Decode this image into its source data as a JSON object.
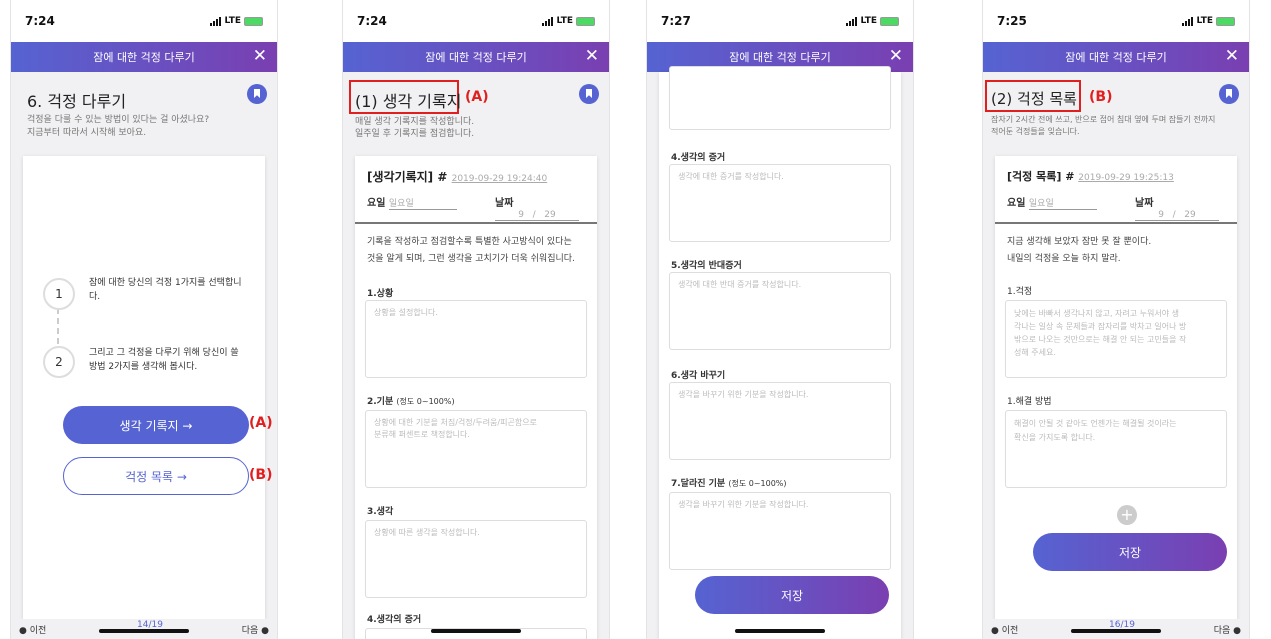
{
  "status": {
    "time1": "7:24",
    "time2": "7:24",
    "time3": "7:27",
    "time4": "7:25",
    "network": "LTE"
  },
  "header_title": "잠에 대한 걱정 다루기",
  "screen1": {
    "title": "6. 걱정 다루기",
    "desc1": "걱정을 다룰 수 있는 방법이 있다는 걸 아셨나요?",
    "desc2": "지금부터 따라서 시작해 보아요.",
    "step1_num": "1",
    "step1_a": "잠에 대한 당신의 걱정 1가지를 선택합니",
    "step1_b": "다.",
    "step2_num": "2",
    "step2_a": "그리고 그 걱정을 다루기 위해 당신이 쓸",
    "step2_b": "방법 2가지를 생각해 봅시다.",
    "btn_record": "생각 기록지  →",
    "btn_list": "걱정 목록   →",
    "annot_a": "(A)",
    "annot_b": "(B)",
    "prev": "이전",
    "page": "14/19",
    "next": "다음"
  },
  "screen2": {
    "title": "(1) 생각 기록지",
    "annot": "(A)",
    "desc1": "매일 생각 기록지를 작성합니다.",
    "desc2": "일주일 후 기록지를 점검합니다.",
    "form_title": "[생각기록지] #",
    "timestamp": "2019-09-29 19:24:40",
    "day_label": "요일",
    "day_value": "일요일",
    "date_label": "날짜",
    "date_month": "9",
    "date_sep": "/",
    "date_day": "29",
    "intro1": "기록을 작성하고 점검할수록 특별한 사고방식이 있다는",
    "intro2": "것을 알게 되며, 그런 생각을 고치기가 더욱 쉬워집니다.",
    "s1": "1.상황",
    "s1_ph": "상황을 설정합니다.",
    "s2": "2.기분",
    "s2_note": "(정도 0~100%)",
    "s2_ph1": "상황에 대한 기분을 처짐/걱정/두려움/피곤함으로",
    "s2_ph2": "분류해 퍼센트로 책정합니다.",
    "s3": "3.생각",
    "s3_ph": "상황에 따른 생각을 작성합니다.",
    "s4": "4.생각의 증거"
  },
  "screen3": {
    "s4": "4.생각의 증거",
    "s4_ph": "생각에 대한 증거를 작성합니다.",
    "s5": "5.생각의 반대증거",
    "s5_ph": "생각에 대한 반대 증거를 작성합니다.",
    "s6": "6.생각 바꾸기",
    "s6_ph": "생각을 바꾸기 위한 기분을 작성합니다.",
    "s7": "7.달라진 기분",
    "s7_note": "(정도 0~100%)",
    "s7_ph": "생각을 바꾸기 위한 기분을 작성합니다.",
    "save": "저장"
  },
  "screen4": {
    "title": "(2) 걱정 목록",
    "annot": "(B)",
    "desc1": "잠자기 2시간 전에 쓰고, 반으로 접어 침대 옆에 두며 잠들기 전까지",
    "desc2": "적어둔 걱정들을 잊습니다.",
    "form_title": "[걱정 목록] #",
    "timestamp": "2019-09-29 19:25:13",
    "day_label": "요일",
    "day_value": "일요일",
    "date_label": "날짜",
    "date_month": "9",
    "date_sep": "/",
    "date_day": "29",
    "intro1": "지금 생각해 보았자 잠만 못 잘 뿐이다.",
    "intro2": "내일의 걱정을 오늘 하지 말라.",
    "w1": "1.걱정",
    "w1_ph1": "낮에는 바빠서 생각나지 않고, 자려고 누워서야 생",
    "w1_ph2": "각나는 일상 속 문제들과 잠자리를 박차고 일어나 방",
    "w1_ph3": "밖으로 나오는 것만으로는 해결 안 되는 고민들을 작",
    "w1_ph4": "성해 주세요.",
    "w2": "1.해결 방법",
    "w2_ph1": "해결이 안될 것 같아도 언젠가는 해결될 것이라는",
    "w2_ph2": "확신을 가지도록 합니다.",
    "plus": "+",
    "save": "저장",
    "prev": "이전",
    "page": "16/19",
    "next": "다음"
  },
  "colors": {
    "accent": "#5663d2",
    "accent2": "#7a3fb1",
    "annotation": "#e02020"
  }
}
